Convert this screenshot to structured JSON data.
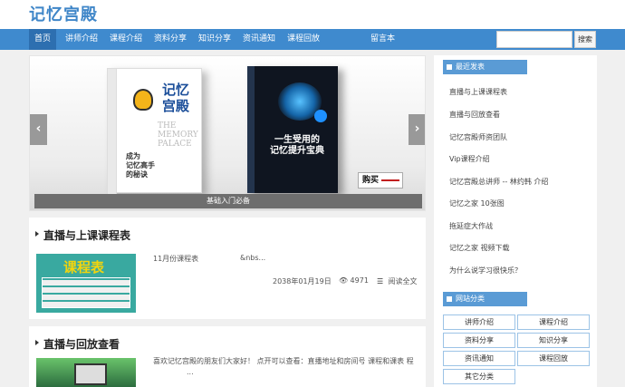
{
  "header": {
    "logo": "记忆宫殿"
  },
  "nav": {
    "items": [
      "首页",
      "讲师介绍",
      "课程介绍",
      "资料分享",
      "知识分享",
      "资讯通知",
      "课程回放",
      "留言本"
    ],
    "search_placeholder": "",
    "search_button": "搜索"
  },
  "slider": {
    "caption": "基础入门必备",
    "prev": "‹",
    "next": "›",
    "book1": {
      "title": "记忆\n宫殿",
      "english": "THE\nMEMORY\nPALACE",
      "subtitle": "成为\n记忆高手\n的秘诀"
    },
    "book2": {
      "title": "一生受用的\n记忆提升宝典"
    },
    "buy": "购买"
  },
  "posts": [
    {
      "title": "直播与上课课程表",
      "thumb_text": "课程表",
      "excerpt": "11月份课程表",
      "ellipsis": "&nbs...",
      "date": "2038年01月19日",
      "views": "4971",
      "read_more": "阅读全文"
    },
    {
      "title": "直播与回放查看",
      "excerpt": "喜欢记忆宫殿的朋友们大家好！ 点开可以查看：直播地址和房间号 课程和课表 程",
      "ellipsis": "..."
    }
  ],
  "sidebar": {
    "recent_title": "最近发表",
    "recent": [
      "直播与上课课程表",
      "直播与回放查看",
      "记忆宫殿师资团队",
      "Vip课程介绍",
      "记忆宫殿总讲师 -- 林约韩 介绍",
      "记忆之家 10张图",
      "拖延症大作战",
      "记忆之家 视频下载",
      "为什么说学习很快乐？"
    ],
    "categories_title": "网站分类",
    "categories": [
      "讲师介绍",
      "课程介绍",
      "资料分享",
      "知识分享",
      "资讯通知",
      "课程回放",
      "其它分类"
    ]
  },
  "colors": {
    "nav_bg": "#3f8ace",
    "brand": "#3f86c8",
    "side_head": "#5a9bd5"
  }
}
